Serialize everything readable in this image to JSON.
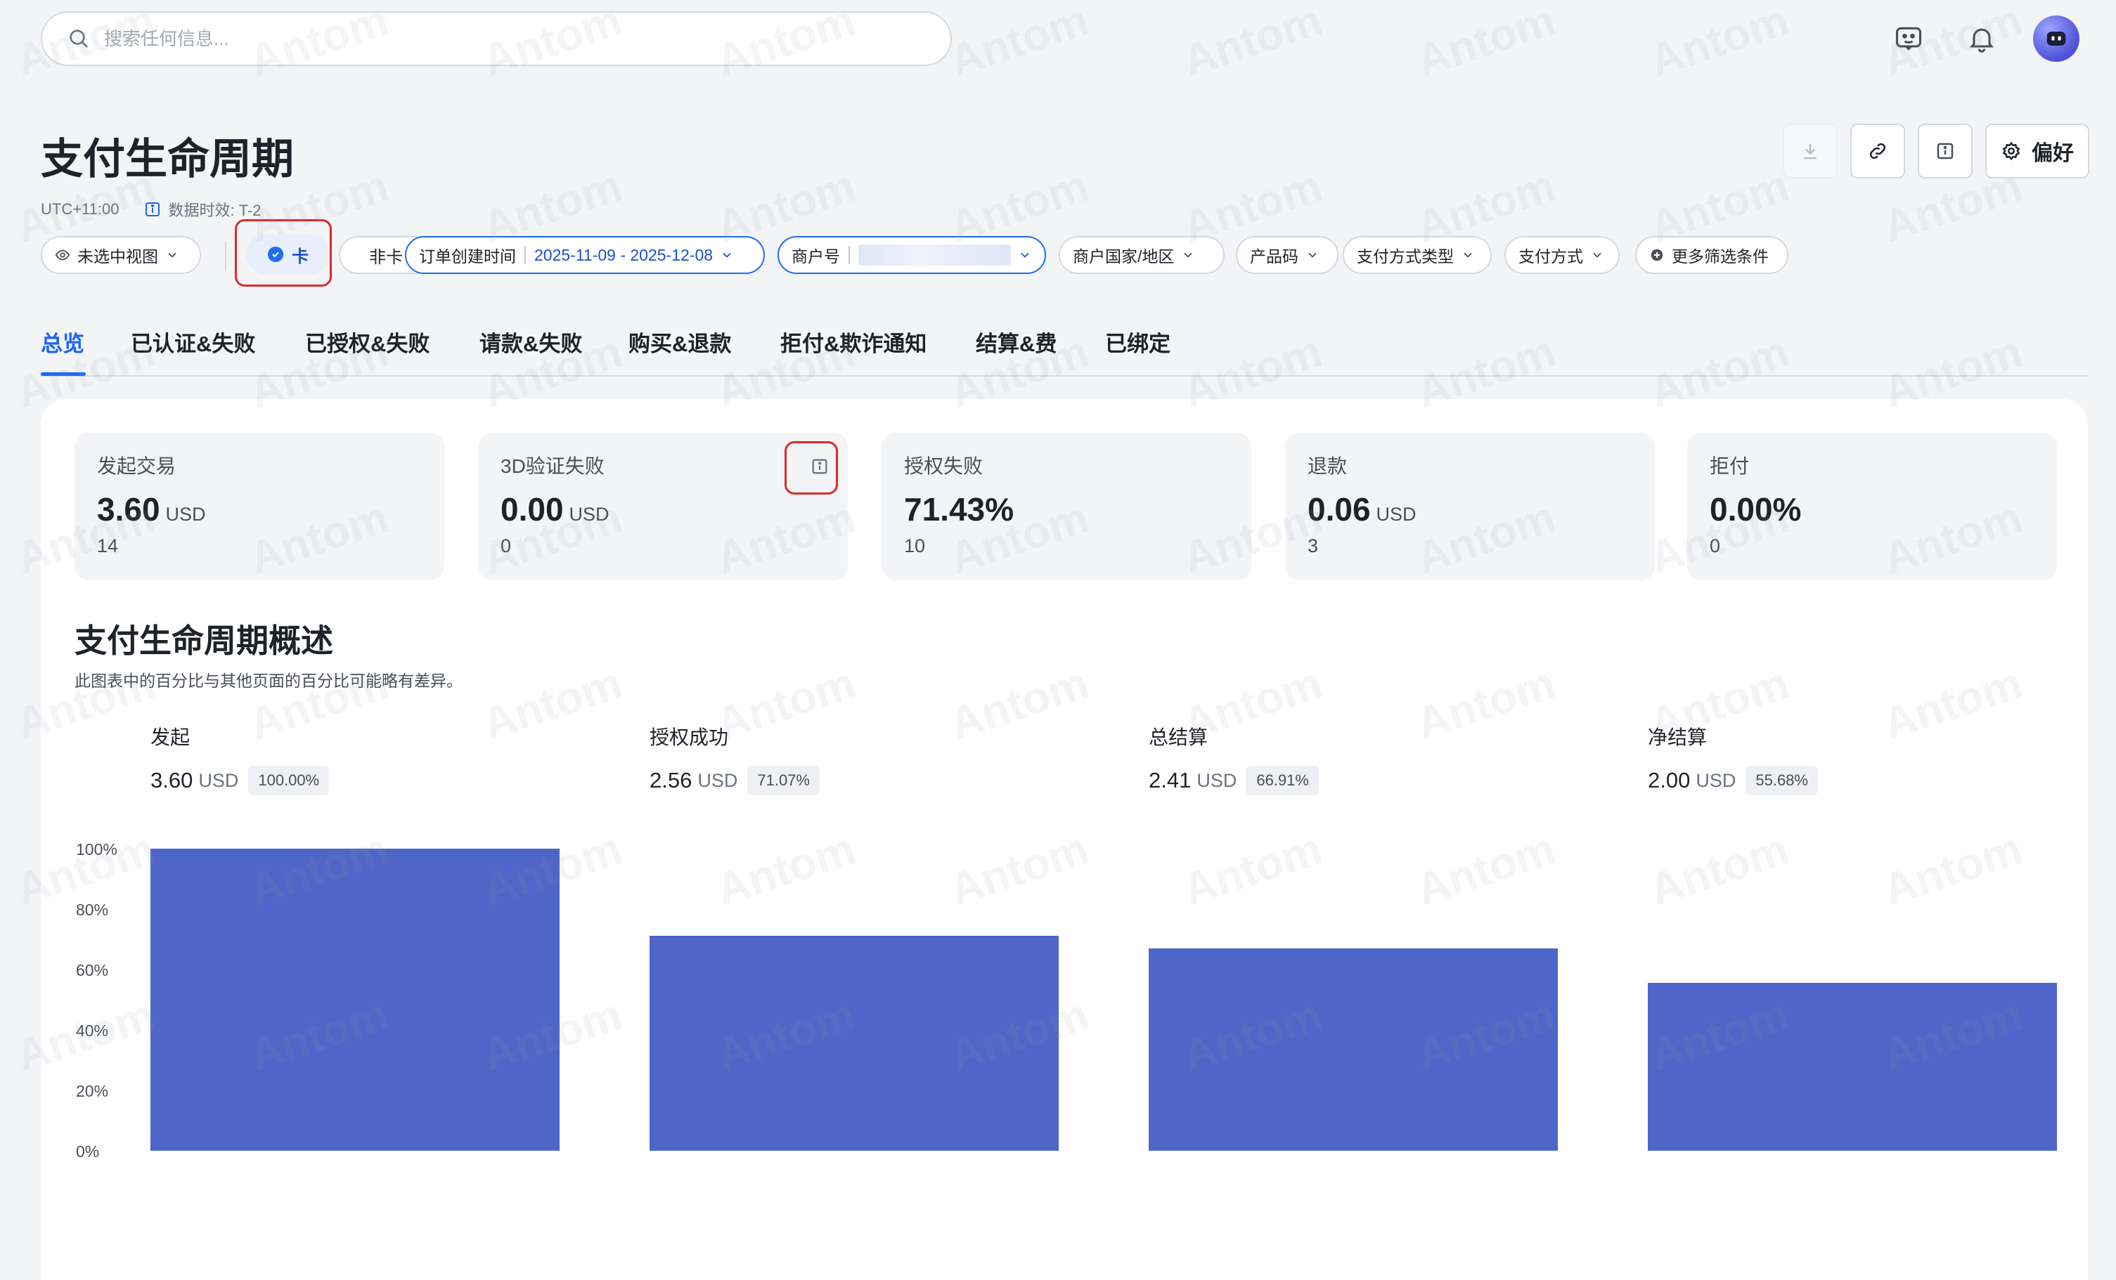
{
  "search": {
    "placeholder": "搜索任何信息..."
  },
  "header": {
    "title": "支付生命周期",
    "timezone": "UTC+11:00",
    "data_freshness": "数据时效: T-2",
    "preferences_label": "偏好"
  },
  "filters": {
    "view": "未选中视图",
    "card_toggle": "卡",
    "non_card_toggle": "非卡",
    "order_time_label": "订单创建时间",
    "order_time_value": "2025-11-09 - 2025-12-08",
    "merchant_id_label": "商户号",
    "merchant_country": "商户国家/地区",
    "product_code": "产品码",
    "payment_method_type": "支付方式类型",
    "payment_method": "支付方式",
    "more_filters": "更多筛选条件"
  },
  "tabs": [
    "总览",
    "已认证&失败",
    "已授权&失败",
    "请款&失败",
    "购买&退款",
    "拒付&欺诈通知",
    "结算&费",
    "已绑定"
  ],
  "metrics": [
    {
      "label": "发起交易",
      "value": "3.60",
      "unit": "USD",
      "count": "14"
    },
    {
      "label": "3D验证失败",
      "value": "0.00",
      "unit": "USD",
      "count": "0"
    },
    {
      "label": "授权失败",
      "value": "71.43%",
      "unit": "",
      "count": "10"
    },
    {
      "label": "退款",
      "value": "0.06",
      "unit": "USD",
      "count": "3"
    },
    {
      "label": "拒付",
      "value": "0.00%",
      "unit": "",
      "count": "0"
    }
  ],
  "overview": {
    "title": "支付生命周期概述",
    "subtitle": "此图表中的百分比与其他页面的百分比可能略有差异。"
  },
  "stages": [
    {
      "name": "发起",
      "value": "3.60",
      "unit": "USD",
      "pct": "100.00%"
    },
    {
      "name": "授权成功",
      "value": "2.56",
      "unit": "USD",
      "pct": "71.07%"
    },
    {
      "name": "总结算",
      "value": "2.41",
      "unit": "USD",
      "pct": "66.91%"
    },
    {
      "name": "净结算",
      "value": "2.00",
      "unit": "USD",
      "pct": "55.68%"
    }
  ],
  "chart_data": {
    "type": "bar",
    "categories": [
      "发起",
      "授权成功",
      "总结算",
      "净结算"
    ],
    "values": [
      100.0,
      71.07,
      66.91,
      55.68
    ],
    "ylim": [
      0,
      100
    ],
    "yticks": [
      "0%",
      "20%",
      "40%",
      "60%",
      "80%",
      "100%"
    ],
    "bar_color": "#4e66c7"
  },
  "watermark": "Antom",
  "colors": {
    "accent": "#1664ff",
    "highlight": "#e0282e"
  }
}
